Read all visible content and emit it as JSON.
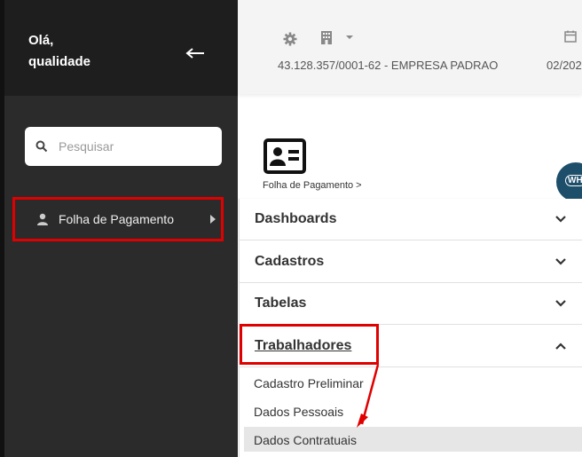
{
  "sidebar": {
    "greeting_line1": "Olá,",
    "greeting_line2": "qualidade",
    "back_icon": "arrow-left-icon",
    "search": {
      "placeholder": "Pesquisar",
      "value": ""
    },
    "items": [
      {
        "label": "Folha de Pagamento",
        "icon": "person-icon"
      }
    ]
  },
  "header": {
    "company": "43.128.357/0001-62 - EMPRESA PADRAO",
    "date": "02/202"
  },
  "page": {
    "breadcrumb": "Folha de Pagamento  >",
    "badge_text": "WH"
  },
  "menu": {
    "sections": [
      {
        "label": "Dashboards",
        "expanded": false
      },
      {
        "label": "Cadastros",
        "expanded": false
      },
      {
        "label": "Tabelas",
        "expanded": false
      },
      {
        "label": "Trabalhadores",
        "expanded": true
      }
    ],
    "sub_items": [
      {
        "label": "Cadastro Preliminar",
        "selected": false
      },
      {
        "label": "Dados Pessoais",
        "selected": false
      },
      {
        "label": "Dados Contratuais",
        "selected": true
      }
    ]
  },
  "colors": {
    "sidebar_top": "#1e1e1e",
    "sidebar_body": "#2b2b2b",
    "annotation_red": "#e00000",
    "selected_row": "#e6e6e6"
  }
}
